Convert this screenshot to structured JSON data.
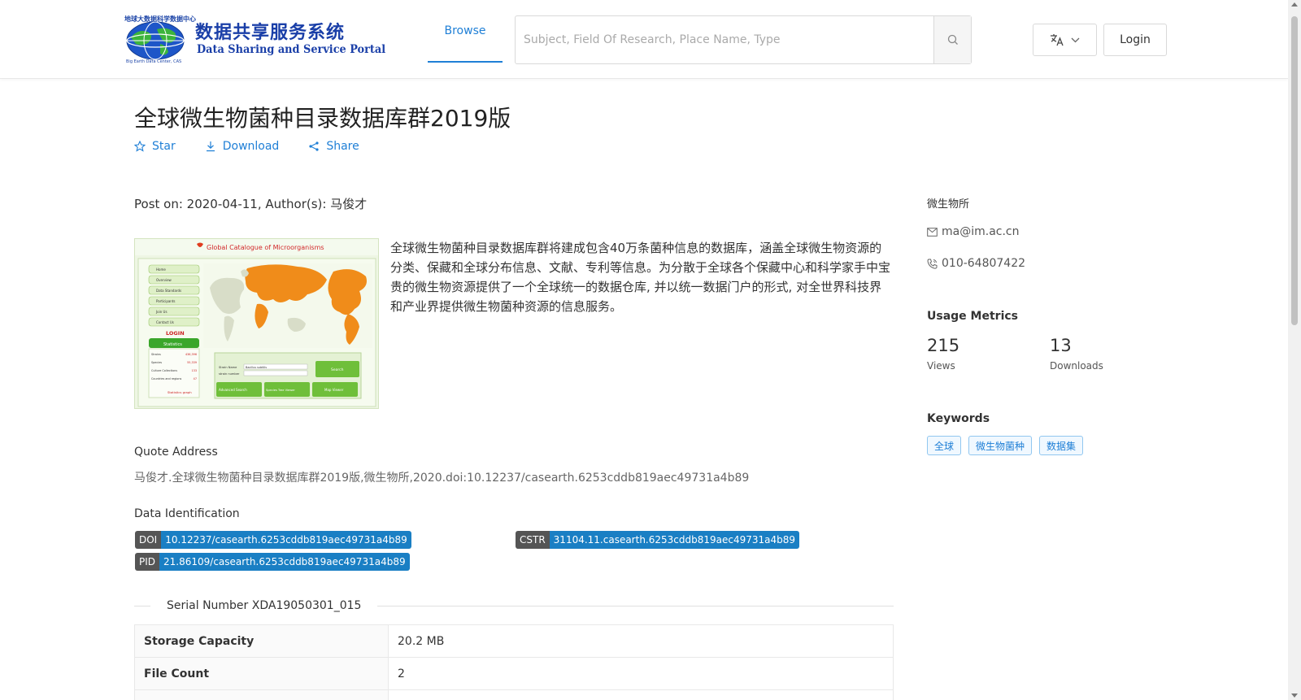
{
  "header": {
    "logo": {
      "cn": "数据共享服务系统",
      "en": "Data Sharing and Service Portal",
      "top_text": "地球大数据科学数据中心",
      "bottom_text": "Big Earth Data Center, CAS"
    },
    "nav": {
      "browse": "Browse"
    },
    "search": {
      "placeholder": "Subject, Field Of Research, Place Name, Type",
      "value": ""
    },
    "lang_icon": "translate-icon",
    "login": "Login"
  },
  "dataset": {
    "title": "全球微生物菌种目录数据库群2019版",
    "actions": {
      "star": "Star",
      "download": "Download",
      "share": "Share"
    },
    "post_info": "Post on: 2020-04-11, Author(s): 马俊才",
    "thumbnail": {
      "title": "Global Catalogue of Microorganisms",
      "menu": [
        "Home",
        "Overview",
        "Data Standards",
        "Participants",
        "Join Us",
        "Contact Us"
      ],
      "login": "LOGIN",
      "stats_title": "Statistics",
      "stats": [
        {
          "k": "Strains",
          "v": "436,396"
        },
        {
          "k": "Species",
          "v": "55,339"
        },
        {
          "k": "Culture Collections",
          "v": "133"
        },
        {
          "k": "Countries and regions",
          "v": "47"
        }
      ],
      "stats_link": "Statistics graph",
      "form": {
        "name_label": "Strain Name",
        "name_value": "Bacillus subtilis",
        "number_label": "strain number",
        "search": "Search",
        "advanced": "Advanced Search",
        "species": "Species Tree Viewer",
        "map": "Map Viewer"
      }
    },
    "description": "全球微生物菌种目录数据库群将建成包含40万条菌种信息的数据库，涵盖全球微生物资源的分类、保藏和全球分布信息、文献、专利等信息。为分散于全球各个保藏中心和科学家手中宝贵的微生物资源提供了一个全球统一的数据仓库, 并以统一数据门户的形式, 对全世界科技界和产业界提供微生物菌种资源的信息服务。",
    "quote_label": "Quote Address",
    "quote": "马俊才.全球微生物菌种目录数据库群2019版,微生物所,2020.doi:10.12237/casearth.6253cddb819aec49731a4b89",
    "identification_label": "Data Identification",
    "identifiers": {
      "doi": {
        "k": "DOI",
        "v": "10.12237/casearth.6253cddb819aec49731a4b89"
      },
      "cstr": {
        "k": "CSTR",
        "v": "31104.11.casearth.6253cddb819aec49731a4b89"
      },
      "pid": {
        "k": "PID",
        "v": "21.86109/casearth.6253cddb819aec49731a4b89"
      }
    },
    "serial": "Serial Number XDA19050301_015",
    "table": [
      {
        "k": "Storage Capacity",
        "v": "20.2 MB"
      },
      {
        "k": "File Count",
        "v": "2"
      }
    ]
  },
  "sidebar": {
    "org": "微生物所",
    "email": "ma@im.ac.cn",
    "phone": "010-64807422",
    "metrics_title": "Usage Metrics",
    "views": "215",
    "views_label": "Views",
    "downloads": "13",
    "downloads_label": "Downloads",
    "keywords_title": "Keywords",
    "keywords": [
      "全球",
      "微生物菌种",
      "数据集"
    ]
  },
  "colors": {
    "accent": "#1f7fd6",
    "badge_value": "#1a7fc4",
    "map_orange": "#f08c1a"
  }
}
